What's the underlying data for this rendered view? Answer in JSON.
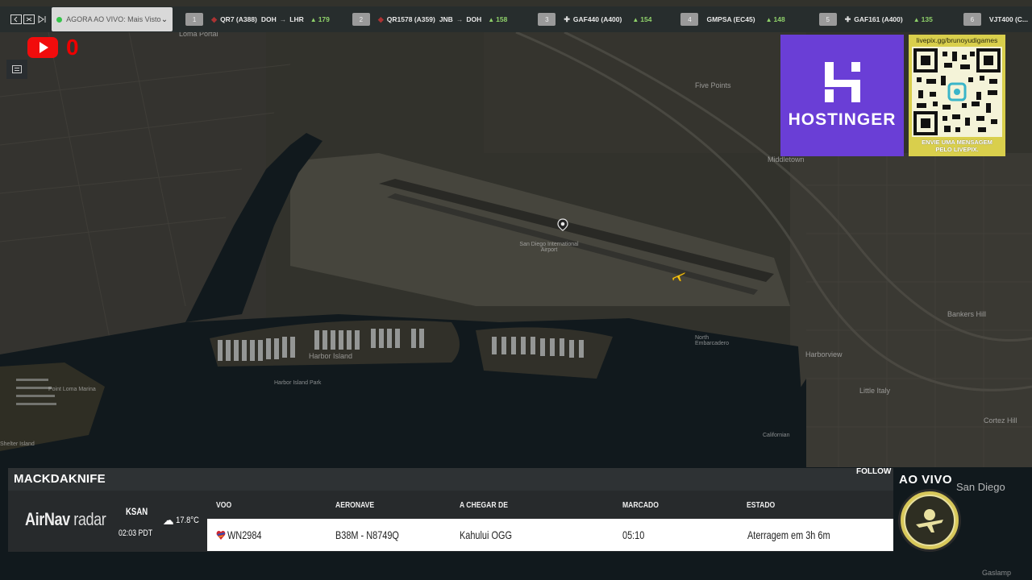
{
  "topbar": {
    "live_label": "AGORA AO VIVO: Mais Vistos",
    "flights": [
      {
        "rank": "1",
        "code": "QR7 (A388)",
        "from": "DOH",
        "to": "LHR",
        "count": "179"
      },
      {
        "rank": "2",
        "code": "QR1578 (A359)",
        "from": "JNB",
        "to": "DOH",
        "count": "158"
      },
      {
        "rank": "3",
        "code": "GAF440 (A400)",
        "from": "",
        "to": "",
        "count": "154"
      },
      {
        "rank": "4",
        "code": "GMPSA (EC45)",
        "from": "",
        "to": "",
        "count": "148"
      },
      {
        "rank": "5",
        "code": "GAF161 (A400)",
        "from": "",
        "to": "",
        "count": "135"
      },
      {
        "rank": "6",
        "code": "VJT400 (C...",
        "from": "",
        "to": "",
        "count": ""
      }
    ]
  },
  "youtube": {
    "count": "0"
  },
  "sponsors": {
    "hostinger": "HOSTINGER",
    "livepix_url": "livepix.gg/brunoyudigames",
    "livepix_msg_1": "ENVIE UMA MENSAGEM",
    "livepix_msg_2": "PELO LIVEPIX."
  },
  "map": {
    "labels": [
      "Loma Portal",
      "Five Points",
      "Middletown",
      "San Diego International Airport",
      "Harbor Island",
      "Harbor Island Park",
      "Shelter Island",
      "Point Loma Marina",
      "Little Italy",
      "Bankers Hill",
      "Cortez Hill",
      "Harborview",
      "North Embarcadero",
      "San Diego",
      "Gaslamp",
      "Californian"
    ]
  },
  "panel": {
    "callsign": "MACKDAKNIFE",
    "follow": "FOLLOW",
    "brand_bold": "AirNav",
    "brand_rest": "radar",
    "airport": "KSAN",
    "local_time": "02:03 PDT",
    "weather": "17.8°C",
    "headers": {
      "flight": "VOO",
      "aircraft": "AERONAVE",
      "origin": "A CHEGAR DE",
      "scheduled": "MARCADO",
      "status": "ESTADO"
    },
    "row": {
      "flight": "WN2984",
      "aircraft": "B38M - N8749Q",
      "origin": "Kahului OGG",
      "scheduled": "05:10",
      "status": "Aterragem em 3h 6m"
    }
  },
  "live_badge": "AO VIVO",
  "colors": {
    "hostinger_bg": "#6a3ed6",
    "livepix_bg": "#d9cf4c",
    "youtube_red": "#f20c0c",
    "count_green": "#8fd16a",
    "plane_yellow": "#f2c21b"
  }
}
